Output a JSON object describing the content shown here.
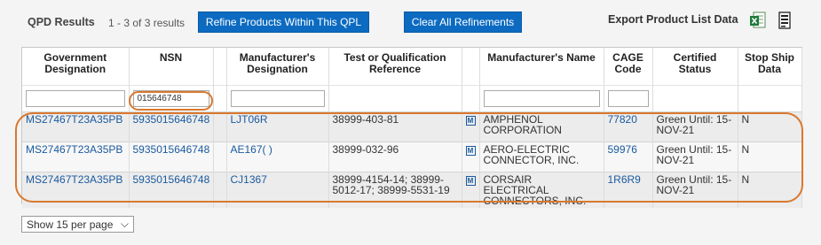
{
  "header": {
    "title": "QPD Results",
    "count": "1 - 3 of 3 results",
    "refine_button": "Refine Products Within This QPL",
    "clear_button": "Clear All Refinements",
    "export_label": "Export Product List Data",
    "icons": [
      "excel-icon",
      "print-icon"
    ]
  },
  "table": {
    "headers": {
      "gov": "Government Designation",
      "nsn": "NSN",
      "mfr_des": "Manufacturer's Designation",
      "test": "Test or Qualification Reference",
      "mfr_name": "Manufacturer's Name",
      "cage": "CAGE Code",
      "cert": "Certified Status",
      "stop": "Stop Ship Data"
    },
    "filters": {
      "nsn_value": "015646748"
    },
    "rows": [
      {
        "gov": "MS27467T23A35PB",
        "nsn": "5935015646748",
        "mfr_des": "LJT06R",
        "test": "38999-403-81",
        "mfr_name": "AMPHENOL CORPORATION",
        "cage": "77820",
        "cert": "Green Until: 15-NOV-21",
        "stop": "N"
      },
      {
        "gov": "MS27467T23A35PB",
        "nsn": "5935015646748",
        "mfr_des": "AE167( )",
        "test": "38999-032-96",
        "mfr_name": "AERO-ELECTRIC CONNECTOR, INC.",
        "cage": "59976",
        "cert": "Green Until: 15-NOV-21",
        "stop": "N"
      },
      {
        "gov": "MS27467T23A35PB",
        "nsn": "5935015646748",
        "mfr_des": "CJ1367",
        "test": "38999-4154-14; 38999-5012-17; 38999-5531-19",
        "mfr_name": "CORSAIR ELECTRICAL CONNECTORS, INC.",
        "cage": "1R6R9",
        "cert": "Green Until: 15-NOV-21",
        "stop": "N"
      }
    ],
    "m_icon_letter": "M"
  },
  "pager": {
    "label": "Show 15 per page",
    "chevron": "⌵"
  },
  "colors": {
    "button_blue": "#0c6bc1",
    "link_blue": "#1a5a9e",
    "highlight_orange": "#d9782e"
  }
}
